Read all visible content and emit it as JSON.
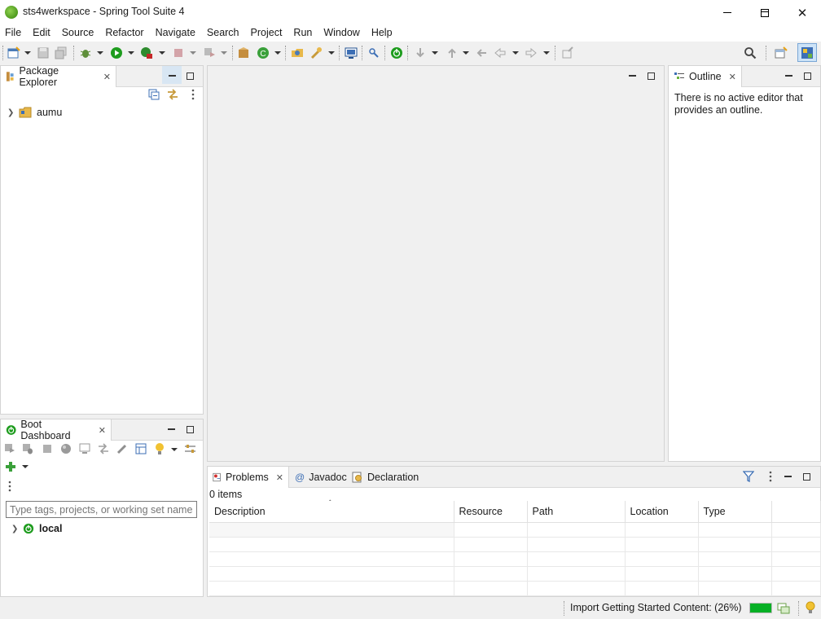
{
  "window": {
    "title": "sts4werkspace - Spring Tool Suite 4",
    "minimize_glyph": "—",
    "maximize_glyph": "☐",
    "close_glyph": "✕"
  },
  "menu": [
    "File",
    "Edit",
    "Source",
    "Refactor",
    "Navigate",
    "Search",
    "Project",
    "Run",
    "Window",
    "Help"
  ],
  "package_explorer": {
    "tab_label": "Package Explorer",
    "tree": [
      {
        "label": "aumu",
        "icon": "project-folder-icon",
        "expanded": false
      }
    ]
  },
  "outline": {
    "tab_label": "Outline",
    "message": "There is no active editor that provides an outline."
  },
  "boot_dashboard": {
    "tab_label": "Boot Dashboard",
    "filter_placeholder": "Type tags, projects, or working set names",
    "tree": [
      {
        "label": "local",
        "icon": "spring-boot-icon",
        "expanded": false
      }
    ]
  },
  "bottom_tabs": [
    {
      "label": "Problems",
      "icon": "problems-icon",
      "active": true
    },
    {
      "label": "Javadoc",
      "icon": "at-icon",
      "active": false
    },
    {
      "label": "Declaration",
      "icon": "declaration-icon",
      "active": false
    }
  ],
  "problems": {
    "count_label": "0 items",
    "columns": [
      "Description",
      "Resource",
      "Path",
      "Location",
      "Type"
    ],
    "rows": []
  },
  "status": {
    "progress_text": "Import Getting Started Content: (26%)",
    "progress_fraction": 0.26
  },
  "colors": {
    "spring_green": "#6db33f",
    "progress_green": "#06b025",
    "run_green": "#1e9c1e"
  }
}
